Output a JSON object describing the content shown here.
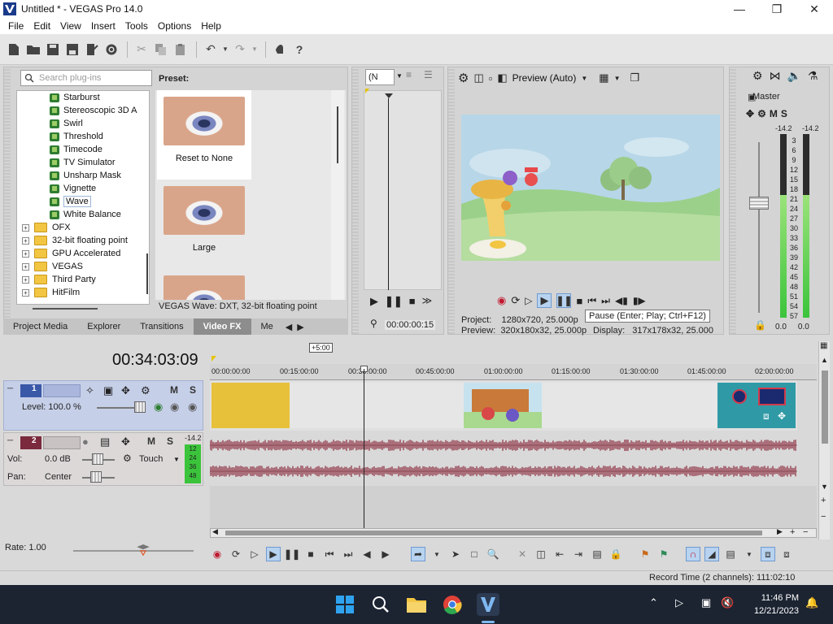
{
  "window": {
    "title": "Untitled * - VEGAS Pro 14.0",
    "minimize": "—",
    "maximize": "❐",
    "close": "✕"
  },
  "menu": [
    "File",
    "Edit",
    "View",
    "Insert",
    "Tools",
    "Options",
    "Help"
  ],
  "plugins": {
    "search_placeholder": "Search plug-ins",
    "effects": [
      "Starburst",
      "Stereoscopic 3D A",
      "Swirl",
      "Threshold",
      "Timecode",
      "TV Simulator",
      "Unsharp Mask",
      "Vignette",
      "Wave",
      "White Balance"
    ],
    "selected_effect": "Wave",
    "folders": [
      "OFX",
      "32-bit floating point",
      "GPU Accelerated",
      "VEGAS",
      "Third Party",
      "HitFilm"
    ],
    "folder_expander": "+"
  },
  "presets": {
    "label": "Preset:",
    "items": [
      {
        "caption": "Reset to None",
        "selected": true
      },
      {
        "caption": "Large",
        "selected": false
      },
      {
        "caption": "",
        "selected": false
      }
    ],
    "status": "VEGAS Wave: DXT, 32-bit floating point"
  },
  "dock_tabs": [
    "Project Media",
    "Explorer",
    "Transitions",
    "Video FX",
    "Me"
  ],
  "active_dock_tab": "Video FX",
  "trimmer": {
    "select_value": "(N",
    "timecode": "00:00:00:15"
  },
  "preview": {
    "quality": "Preview (Auto)",
    "tooltip": "Pause (Enter; Play; Ctrl+F12)",
    "project_label": "Project:",
    "project_value": "1280x720, 25.000p",
    "preview_label": "Preview:",
    "preview_value": "320x180x32, 25.000p",
    "display_label": "Display:",
    "display_value": "317x178x32, 25.000"
  },
  "master": {
    "label": "Master",
    "mute": "M",
    "solo": "S",
    "peak_left": "-14.2",
    "peak_right": "-14.2",
    "scale": [
      "3",
      "6",
      "9",
      "12",
      "15",
      "18",
      "21",
      "24",
      "27",
      "30",
      "33",
      "36",
      "39",
      "42",
      "45",
      "48",
      "51",
      "54",
      "57"
    ],
    "level_left": 0.67,
    "level_right": 0.67,
    "out_left": "0.0",
    "out_right": "0.0"
  },
  "timeline": {
    "time": "00:34:03:09",
    "marker": "+5:00",
    "ruler": [
      "00:00:00:00",
      "00:15:00:00",
      "00:30:00:00",
      "00:45:00:00",
      "01:00:00:00",
      "01:15:00:00",
      "01:30:00:00",
      "01:45:00:00",
      "02:00:00:00"
    ],
    "video_track": {
      "number": "1",
      "level": "Level: 100.0 %",
      "mute": "M",
      "solo": "S"
    },
    "audio_track": {
      "number": "2",
      "vol_label": "Vol:",
      "vol_value": "0.0 dB",
      "pan_label": "Pan:",
      "pan_value": "Center",
      "mode": "Touch",
      "mute": "M",
      "solo": "S",
      "peak": "-14.2",
      "meter_scale": [
        "12",
        "24",
        "36",
        "48"
      ]
    },
    "rate": "Rate: 1.00"
  },
  "status": {
    "record_time": "Record Time (2 channels): 111:02:10"
  },
  "taskbar": {
    "time": "11:46 PM",
    "date": "12/21/2023"
  },
  "colors": {
    "accent": "#1f6fd0",
    "video_track": "#c6cfe8",
    "audio_wave": "#8b2a3c",
    "meter": "#3bc43b"
  }
}
